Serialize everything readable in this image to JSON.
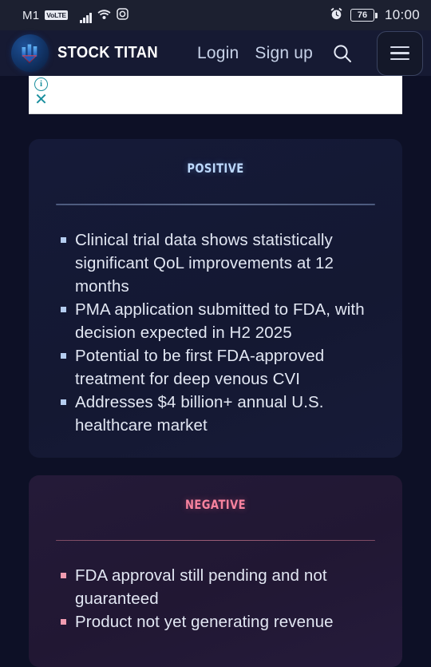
{
  "statusbar": {
    "carrier": "M1",
    "volte_badge": "VoLTE",
    "battery_percent": "76",
    "time": "10:00",
    "icons": [
      "signal-bars-icon",
      "wifi-icon",
      "screen-record-icon",
      "alarm-clock-icon",
      "battery-icon"
    ]
  },
  "header": {
    "brand": "STOCK TITAN",
    "logo_icon": "stock-titan-logo-icon",
    "nav": [
      {
        "label": "Login"
      },
      {
        "label": "Sign up"
      }
    ],
    "search_icon": "search-icon",
    "menu_icon": "hamburger-menu-icon"
  },
  "ad": {
    "info_icon": "info-icon",
    "info_label": "i",
    "close_icon": "close-icon",
    "close_label": "✕"
  },
  "cards": [
    {
      "title": "Positive",
      "accent": "#bcd8fb",
      "bullets": [
        "Clinical trial data shows statistically significant QoL improvements at 12 months",
        "PMA application submitted to FDA, with decision expected in H2 2025",
        "Potential to be first FDA-approved treatment for deep venous CVI",
        "Addresses $4 billion+ annual U.S. healthcare market"
      ]
    },
    {
      "title": "Negative",
      "accent": "#f7829e",
      "bullets": [
        "FDA approval still pending and not guaranteed",
        "Product not yet generating revenue"
      ]
    }
  ]
}
